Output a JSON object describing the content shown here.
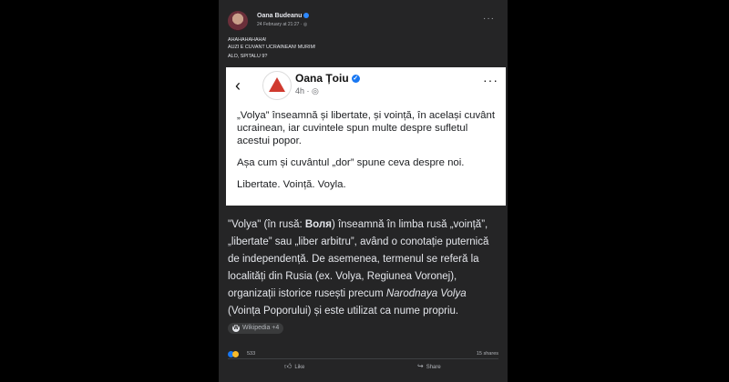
{
  "post": {
    "author": "Oana Budeanu",
    "timestamp": "24 February at 21:27",
    "caption_lines": [
      "AHAHAHAHAHA!",
      "AUZI E CUVANT UCRAINEAN! MURIM!",
      "ALO, SPITALU 9?"
    ]
  },
  "screenshot": {
    "author": "Oana Țoiu",
    "time": "4h",
    "paragraphs": [
      "„Volya” înseamnă și libertate, și voință, în același cuvânt ucrainean, iar cuvintele spun multe despre sufletul acestui popor.",
      "Așa cum și cuvântul „dor” spune ceva despre noi.",
      "Libertate. Voință. Voyla."
    ]
  },
  "context": {
    "p1": "\"Volya\" (în rusă: ",
    "p1_bold": "Воля",
    "p2": ") înseamnă în limba rusă „voință”, „libertate” sau „liber arbitru”, având o conotație puternică de independență. De asemenea, termenul se referă la localități din Rusia (ex. Volya, Regiunea Voronej), organizații istorice rusești precum ",
    "p2_italic": "Narodnaya Volya",
    "p3": " (Voința Poporului) și este utilizat ca nume propriu.",
    "chip": "Wikipedia +4"
  },
  "footer": {
    "reaction_count": "533",
    "shares": "15 shares",
    "like_label": "Like",
    "share_label": "Share"
  },
  "colors": {
    "accent": "#1877f2",
    "background": "#000000",
    "card": "#252526"
  }
}
